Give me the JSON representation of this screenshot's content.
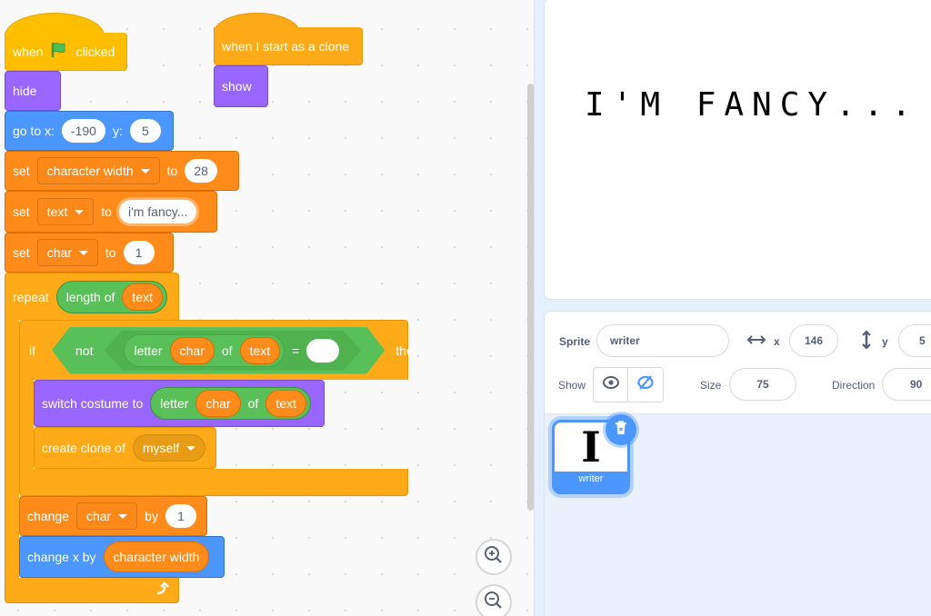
{
  "scripts": {
    "main": {
      "hat": {
        "when": "when",
        "flag_icon": "green-flag-icon",
        "clicked": "clicked"
      },
      "hide": "hide",
      "goto": {
        "label": "go to x:",
        "x": "-190",
        "ylabel": "y:",
        "y": "5"
      },
      "set1": {
        "label": "set",
        "var": "character width",
        "to": "to",
        "value": "28"
      },
      "set2": {
        "label": "set",
        "var": "text",
        "to": "to",
        "value": "i'm fancy..."
      },
      "set3": {
        "label": "set",
        "var": "char",
        "to": "to",
        "value": "1"
      },
      "repeat": {
        "label": "repeat",
        "op": "length of",
        "var": "text"
      },
      "if": {
        "label": "if",
        "not": "not",
        "letter": "letter",
        "char": "char",
        "of": "of",
        "text": "text",
        "eq": "=",
        "value": "",
        "then": "then"
      },
      "switch": {
        "label": "switch costume to",
        "letter": "letter",
        "char": "char",
        "of": "of",
        "text": "text"
      },
      "clone": {
        "label": "create clone of",
        "target": "myself"
      },
      "change1": {
        "label": "change",
        "var": "char",
        "by": "by",
        "value": "1"
      },
      "change2": {
        "label": "change x by",
        "var": "character width"
      },
      "loop_icon": "loop-arrow-icon"
    },
    "clone": {
      "hat": "when I start as a clone",
      "show": "show"
    }
  },
  "stage": {
    "text": "I'M FANCY..."
  },
  "sprite_info": {
    "sprite_label": "Sprite",
    "sprite_name": "writer",
    "x_label": "x",
    "x": "146",
    "y_label": "y",
    "y": "5",
    "show_label": "Show",
    "size_label": "Size",
    "size": "75",
    "direction_label": "Direction",
    "direction": "90"
  },
  "sprites": [
    {
      "name": "writer",
      "costume_glyph": "I",
      "selected": true
    }
  ],
  "colors": {
    "events": "#ffbf00",
    "control": "#ffab19",
    "looks": "#9966ff",
    "motion": "#4c97ff",
    "variables": "#ff8c1a",
    "operators": "#59c059"
  }
}
